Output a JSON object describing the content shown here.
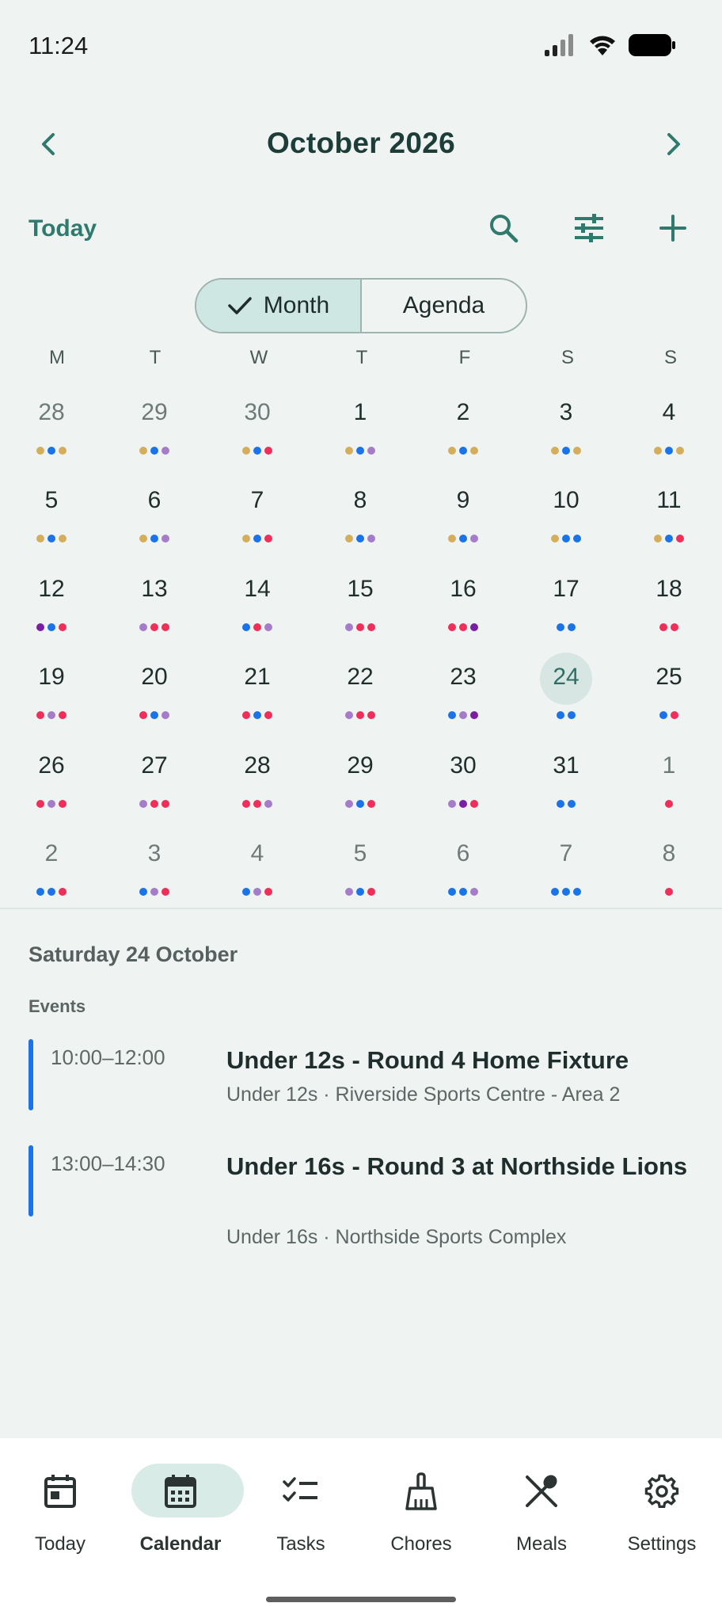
{
  "status": {
    "time": "11:24"
  },
  "header": {
    "month_title": "October 2026"
  },
  "toolbar": {
    "today_label": "Today"
  },
  "view_toggle": {
    "month_label": "Month",
    "agenda_label": "Agenda",
    "selected": "Month"
  },
  "weekdays": [
    "M",
    "T",
    "W",
    "T",
    "F",
    "S",
    "S"
  ],
  "colors": {
    "accent": "#2f7a6d",
    "gold": "#d4ae5c",
    "blue": "#1a73e8",
    "lavender": "#a57cc8",
    "red": "#ef2e5a",
    "purple": "#7b1fa2"
  },
  "calendar": {
    "weeks": [
      [
        {
          "d": "28",
          "other": true,
          "dots": [
            "gold",
            "blue",
            "gold"
          ]
        },
        {
          "d": "29",
          "other": true,
          "dots": [
            "gold",
            "blue",
            "lavender"
          ]
        },
        {
          "d": "30",
          "other": true,
          "dots": [
            "gold",
            "blue",
            "red"
          ]
        },
        {
          "d": "1",
          "dots": [
            "gold",
            "blue",
            "lavender"
          ]
        },
        {
          "d": "2",
          "dots": [
            "gold",
            "blue",
            "gold"
          ]
        },
        {
          "d": "3",
          "dots": [
            "gold",
            "blue",
            "gold"
          ]
        },
        {
          "d": "4",
          "dots": [
            "gold",
            "blue",
            "gold"
          ]
        }
      ],
      [
        {
          "d": "5",
          "dots": [
            "gold",
            "blue",
            "gold"
          ]
        },
        {
          "d": "6",
          "dots": [
            "gold",
            "blue",
            "lavender"
          ]
        },
        {
          "d": "7",
          "dots": [
            "gold",
            "blue",
            "red"
          ]
        },
        {
          "d": "8",
          "dots": [
            "gold",
            "blue",
            "lavender"
          ]
        },
        {
          "d": "9",
          "dots": [
            "gold",
            "blue",
            "lavender"
          ]
        },
        {
          "d": "10",
          "dots": [
            "gold",
            "blue",
            "blue"
          ]
        },
        {
          "d": "11",
          "dots": [
            "gold",
            "blue",
            "red"
          ]
        }
      ],
      [
        {
          "d": "12",
          "dots": [
            "purple",
            "blue",
            "red"
          ]
        },
        {
          "d": "13",
          "dots": [
            "lavender",
            "red",
            "red"
          ]
        },
        {
          "d": "14",
          "dots": [
            "blue",
            "red",
            "lavender"
          ]
        },
        {
          "d": "15",
          "dots": [
            "lavender",
            "red",
            "red"
          ]
        },
        {
          "d": "16",
          "dots": [
            "red",
            "red",
            "purple"
          ]
        },
        {
          "d": "17",
          "dots": [
            "blue",
            "blue"
          ]
        },
        {
          "d": "18",
          "dots": [
            "red",
            "red"
          ]
        }
      ],
      [
        {
          "d": "19",
          "dots": [
            "red",
            "lavender",
            "red"
          ]
        },
        {
          "d": "20",
          "dots": [
            "red",
            "blue",
            "lavender"
          ]
        },
        {
          "d": "21",
          "dots": [
            "red",
            "blue",
            "red"
          ]
        },
        {
          "d": "22",
          "dots": [
            "lavender",
            "red",
            "red"
          ]
        },
        {
          "d": "23",
          "dots": [
            "blue",
            "lavender",
            "purple"
          ]
        },
        {
          "d": "24",
          "selected": true,
          "dots": [
            "blue",
            "blue"
          ]
        },
        {
          "d": "25",
          "dots": [
            "blue",
            "red"
          ]
        }
      ],
      [
        {
          "d": "26",
          "dots": [
            "red",
            "lavender",
            "red"
          ]
        },
        {
          "d": "27",
          "dots": [
            "lavender",
            "red",
            "red"
          ]
        },
        {
          "d": "28",
          "dots": [
            "red",
            "red",
            "lavender"
          ]
        },
        {
          "d": "29",
          "dots": [
            "lavender",
            "blue",
            "red"
          ]
        },
        {
          "d": "30",
          "dots": [
            "lavender",
            "purple",
            "red"
          ]
        },
        {
          "d": "31",
          "dots": [
            "blue",
            "blue"
          ]
        },
        {
          "d": "1",
          "other": true,
          "dots": [
            "red"
          ]
        }
      ],
      [
        {
          "d": "2",
          "other": true,
          "dots": [
            "blue",
            "blue",
            "red"
          ]
        },
        {
          "d": "3",
          "other": true,
          "dots": [
            "blue",
            "lavender",
            "red"
          ]
        },
        {
          "d": "4",
          "other": true,
          "dots": [
            "blue",
            "lavender",
            "red"
          ]
        },
        {
          "d": "5",
          "other": true,
          "dots": [
            "lavender",
            "blue",
            "red"
          ]
        },
        {
          "d": "6",
          "other": true,
          "dots": [
            "blue",
            "blue",
            "lavender"
          ]
        },
        {
          "d": "7",
          "other": true,
          "dots": [
            "blue",
            "blue",
            "blue"
          ]
        },
        {
          "d": "8",
          "other": true,
          "dots": [
            "red"
          ]
        }
      ]
    ]
  },
  "details": {
    "day_heading": "Saturday 24 October",
    "events_label": "Events",
    "events": [
      {
        "time": "10:00–12:00",
        "title": "Under 12s - Round 4 Home Fixture",
        "subtitle": "Under 12s · Riverside Sports Centre - Area 2",
        "color": "#1a73e8"
      },
      {
        "time": "13:00–14:30",
        "title": "Under 16s - Round 3 at Northside Lions",
        "subtitle": "Under 16s · Northside Sports Complex",
        "color": "#1a73e8"
      }
    ]
  },
  "bottom_nav": {
    "items": [
      {
        "label": "Today",
        "icon": "calendar-today-icon"
      },
      {
        "label": "Calendar",
        "icon": "calendar-month-icon",
        "active": true
      },
      {
        "label": "Tasks",
        "icon": "checklist-icon"
      },
      {
        "label": "Chores",
        "icon": "broom-icon"
      },
      {
        "label": "Meals",
        "icon": "utensils-icon"
      },
      {
        "label": "Settings",
        "icon": "gear-icon"
      }
    ]
  }
}
